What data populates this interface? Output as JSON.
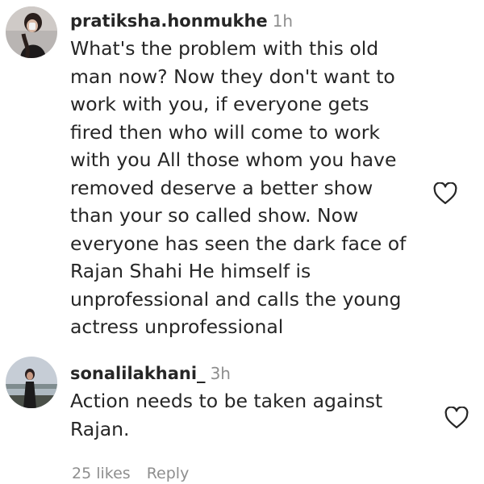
{
  "comments": [
    {
      "username": "pratiksha.honmukhe",
      "time": "1h",
      "text_lines": [
        "What's the problem with this old",
        "man now? Now they don't want to",
        "work with you, if everyone gets",
        "fired then who will come to work",
        "with you All those whom you have",
        "removed deserve a better show",
        "than your so called show. Now",
        "everyone has seen the dark face of",
        "Rajan Shahi He himself is",
        "unprofessional and calls the young",
        "actress unprofessional"
      ],
      "avatar_icon": "profile-photo",
      "like_icon": "heart-outline-icon"
    },
    {
      "username": "sonalilakhani_",
      "time": "3h",
      "text_lines": [
        "Action needs to be taken against",
        "Rajan."
      ],
      "avatar_icon": "profile-photo",
      "like_icon": "heart-outline-icon",
      "likes": "25 likes",
      "reply_label": "Reply"
    }
  ],
  "colors": {
    "primary_text": "#262626",
    "secondary_text": "#8e8e8e",
    "background": "#ffffff"
  }
}
